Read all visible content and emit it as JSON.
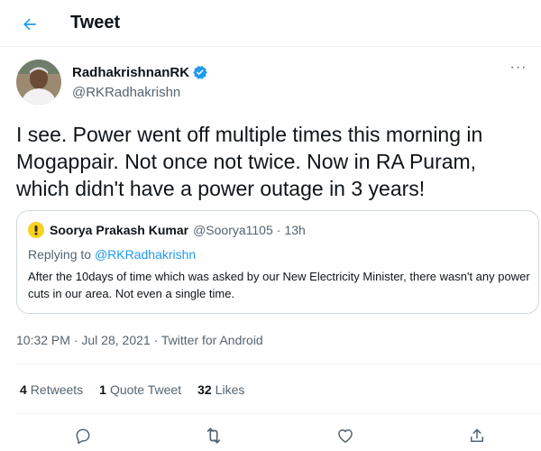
{
  "header": {
    "title": "Tweet",
    "back_icon": "arrow-left-icon"
  },
  "author": {
    "display_name": "RadhakrishnanRK",
    "handle": "@RKRadhakrishn",
    "verified": true,
    "more_icon": "more-horizontal-icon",
    "more_glyph": "···"
  },
  "tweet": {
    "text": "I see. Power went off multiple times this morning in Mogappair. Not once not twice. Now in RA Puram, which didn't have a power outage in 3 years!"
  },
  "quote": {
    "name": "Soorya Prakash Kumar",
    "handle": "@Soorya1105",
    "separator": "·",
    "time": "13h",
    "reply_prefix": "Replying to ",
    "reply_handle": "@RKRadhakrishn",
    "text": "After the 10days of time which was asked by our New Electricity Minister, there wasn't any power cuts in our area. Not even a single time."
  },
  "meta": {
    "time": "10:32 PM",
    "separator1": " · ",
    "date": "Jul 28, 2021",
    "separator2": " · ",
    "source": "Twitter for Android"
  },
  "stats": {
    "retweets_count": "4",
    "retweets_label": "Retweets",
    "quotes_count": "1",
    "quotes_label": "Quote Tweet",
    "likes_count": "32",
    "likes_label": "Likes"
  },
  "actions": [
    "reply-icon",
    "retweet-icon",
    "like-icon",
    "share-icon"
  ],
  "colors": {
    "accent": "#1d9bf0",
    "text": "#0f1419",
    "secondary": "#536471",
    "border": "#cfd9de"
  }
}
